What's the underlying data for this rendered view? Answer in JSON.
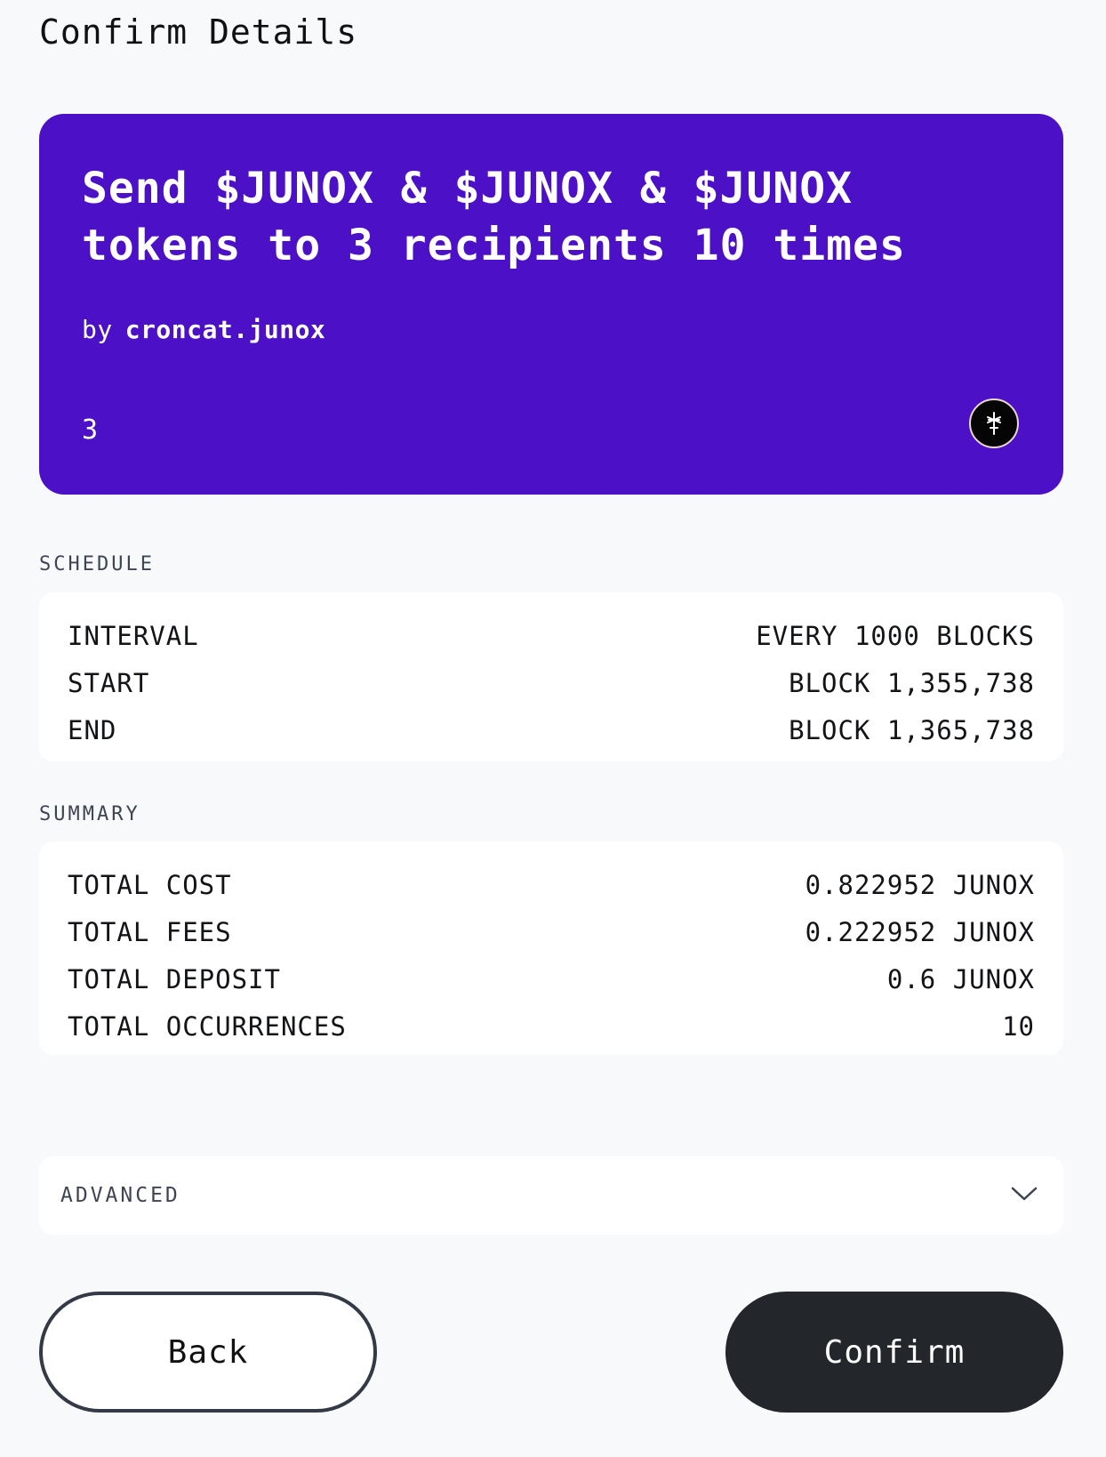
{
  "page": {
    "title": "Confirm Details"
  },
  "card": {
    "title": "Send $JUNOX & $JUNOX & $JUNOX tokens to 3 recipients 10 times",
    "by_label": "by",
    "author": "croncat.junox",
    "count": "3",
    "background_color": "#4c10c6",
    "avatar_icon": "croncat-logo-icon"
  },
  "schedule": {
    "label": "SCHEDULE",
    "rows": [
      {
        "key": "INTERVAL",
        "value": "EVERY 1000 BLOCKS"
      },
      {
        "key": "START",
        "value": "BLOCK 1,355,738"
      },
      {
        "key": "END",
        "value": "BLOCK 1,365,738"
      }
    ]
  },
  "summary": {
    "label": "SUMMARY",
    "rows": [
      {
        "key": "TOTAL COST",
        "value": "0.822952 JUNOX"
      },
      {
        "key": "TOTAL FEES",
        "value": "0.222952 JUNOX"
      },
      {
        "key": "TOTAL DEPOSIT",
        "value": "0.6 JUNOX"
      },
      {
        "key": "TOTAL OCCURRENCES",
        "value": "10"
      }
    ]
  },
  "advanced": {
    "label": "ADVANCED",
    "icon": "chevron-down-icon"
  },
  "buttons": {
    "back_label": "Back",
    "confirm_label": "Confirm",
    "confirm_color": "#23272b"
  }
}
